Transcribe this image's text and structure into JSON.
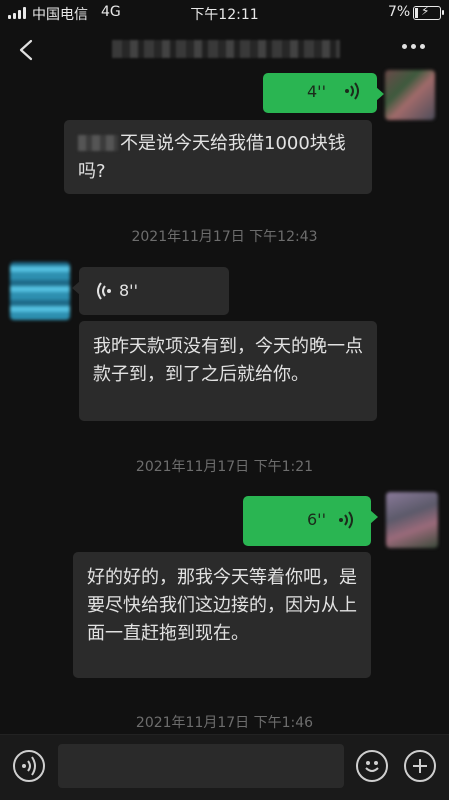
{
  "status": {
    "carrier": "中国电信",
    "network": "4G",
    "time": "下午12:11",
    "battery": "7%"
  },
  "messages": {
    "voice_me_1": {
      "duration": "4''"
    },
    "text_them_1": {
      "text": "不是说今天给我借1000块钱吗?"
    },
    "ts_1": "2021年11月17日 下午12:43",
    "voice_them_1": {
      "duration": "8''"
    },
    "text_them_2": {
      "text": "我昨天款项没有到，今天的晚一点款子到，到了之后就给你。"
    },
    "ts_2": "2021年11月17日 下午1:21",
    "voice_me_2": {
      "duration": "6''"
    },
    "text_them_3": {
      "text": "好的好的，那我今天等着你吧，是要尽快给我们这边接的，因为从上面一直赶拖到现在。"
    },
    "ts_3": "2021年11月17日 下午1:46"
  },
  "colors": {
    "my_bubble": "#2ab552",
    "their_bubble": "#2b2b2b",
    "background": "#111111"
  },
  "icons": [
    "back-arrow",
    "more-dots",
    "voice-wave",
    "microphone-toggle",
    "emoji-face",
    "plus"
  ]
}
